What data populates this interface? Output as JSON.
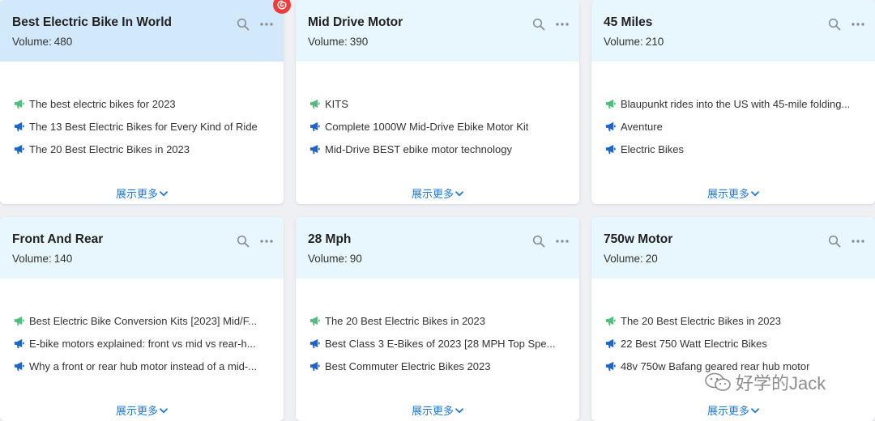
{
  "volume_label": "Volume:",
  "show_more_label": "展示更多",
  "colors": {
    "green_icon": "#52bc7d",
    "blue_icon": "#1e65c7",
    "link": "#1b78d8"
  },
  "cards": [
    {
      "title": "Best Electric Bike In World",
      "volume": "480",
      "items": [
        {
          "icon": "green-megaphone-icon",
          "text": "The best electric bikes for 2023"
        },
        {
          "icon": "blue-megaphone-icon",
          "text": "The 13 Best Electric Bikes for Every Kind of Ride"
        },
        {
          "icon": "blue-megaphone-icon",
          "text": "The 20 Best Electric Bikes in 2023"
        }
      ]
    },
    {
      "title": "Mid Drive Motor",
      "volume": "390",
      "items": [
        {
          "icon": "green-megaphone-icon",
          "text": "KITS"
        },
        {
          "icon": "blue-megaphone-icon",
          "text": "Complete 1000W Mid-Drive Ebike Motor Kit"
        },
        {
          "icon": "blue-megaphone-icon",
          "text": "Mid-Drive BEST ebike motor technology"
        }
      ]
    },
    {
      "title": "45 Miles",
      "volume": "210",
      "items": [
        {
          "icon": "green-megaphone-icon",
          "text": "Blaupunkt rides into the US with 45-mile folding..."
        },
        {
          "icon": "blue-megaphone-icon",
          "text": "Aventure"
        },
        {
          "icon": "blue-megaphone-icon",
          "text": "Electric Bikes"
        }
      ]
    },
    {
      "title": "Front And Rear",
      "volume": "140",
      "items": [
        {
          "icon": "green-megaphone-icon",
          "text": "Best Electric Bike Conversion Kits [2023] Mid/F..."
        },
        {
          "icon": "blue-megaphone-icon",
          "text": "E-bike motors explained: front vs mid vs rear-h..."
        },
        {
          "icon": "blue-megaphone-icon",
          "text": "Why a front or rear hub motor instead of a mid-..."
        }
      ]
    },
    {
      "title": "28 Mph",
      "volume": "90",
      "items": [
        {
          "icon": "green-megaphone-icon",
          "text": "The 20 Best Electric Bikes in 2023"
        },
        {
          "icon": "blue-megaphone-icon",
          "text": "Best Class 3 E-Bikes of 2023 [28 MPH Top Spe..."
        },
        {
          "icon": "blue-megaphone-icon",
          "text": "Best Commuter Electric Bikes 2023"
        }
      ]
    },
    {
      "title": "750w Motor",
      "volume": "20",
      "items": [
        {
          "icon": "green-megaphone-icon",
          "text": "The 20 Best Electric Bikes in 2023"
        },
        {
          "icon": "blue-megaphone-icon",
          "text": "22 Best 750 Watt Electric Bikes"
        },
        {
          "icon": "blue-megaphone-icon",
          "text": "48v 750w Bafang geared rear hub motor"
        }
      ]
    }
  ],
  "watermark": {
    "text": "好学的Jack",
    "icon": "wechat-logo-icon"
  }
}
